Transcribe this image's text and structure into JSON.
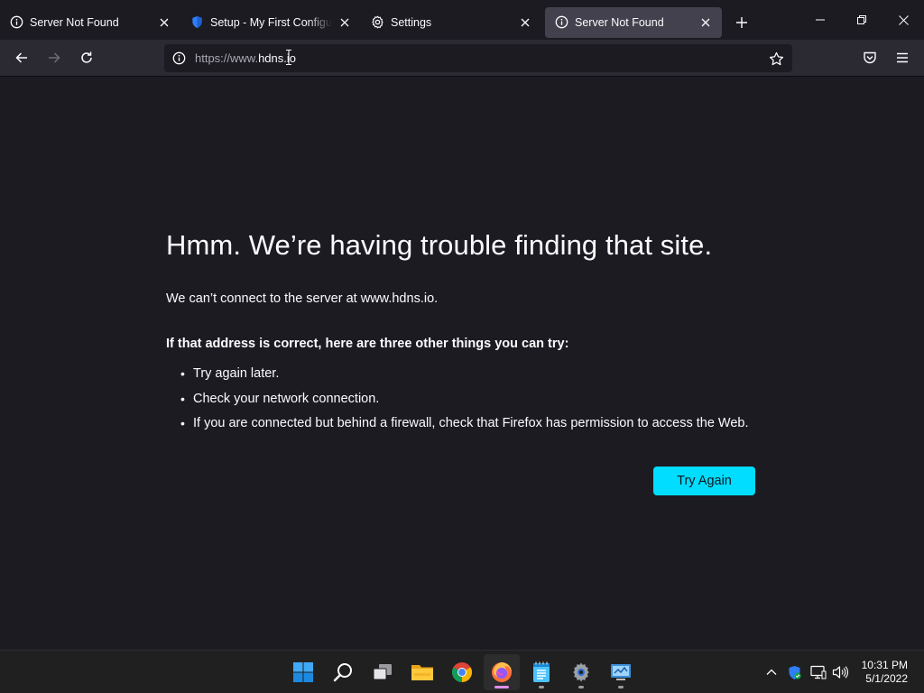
{
  "tabs": [
    {
      "title": "Server Not Found",
      "icon": "info-icon",
      "active": false
    },
    {
      "title": "Setup - My First Configurati",
      "icon": "shield-icon",
      "active": false
    },
    {
      "title": "Settings",
      "icon": "gear-icon",
      "active": false
    },
    {
      "title": "Server Not Found",
      "icon": "info-icon",
      "active": true
    }
  ],
  "urlbar": {
    "scheme": "https://www.",
    "host": "hdns.io"
  },
  "error": {
    "title": "Hmm. We’re having trouble finding that site.",
    "description": "We can’t connect to the server at www.hdns.io.",
    "suggestion_heading": "If that address is correct, here are three other things you can try:",
    "suggestions": [
      "Try again later.",
      "Check your network connection.",
      "If you are connected but behind a firewall, check that Firefox has permission to access the Web."
    ],
    "button_label": "Try Again"
  },
  "taskbar": {
    "apps": [
      "windows-start-icon",
      "search-icon",
      "task-view-icon",
      "file-explorer-icon",
      "chrome-icon",
      "firefox-icon",
      "notepad-icon",
      "settings-icon",
      "control-panel-icon"
    ],
    "tray": [
      "chevron-up-icon",
      "defender-icon",
      "network-icon",
      "volume-icon"
    ],
    "time": "10:31 PM",
    "date": "5/1/2022"
  },
  "colors": {
    "accent": "#00ddff",
    "background": "#1c1b22",
    "toolbar": "#2b2a33",
    "active_tab": "#42414d"
  }
}
